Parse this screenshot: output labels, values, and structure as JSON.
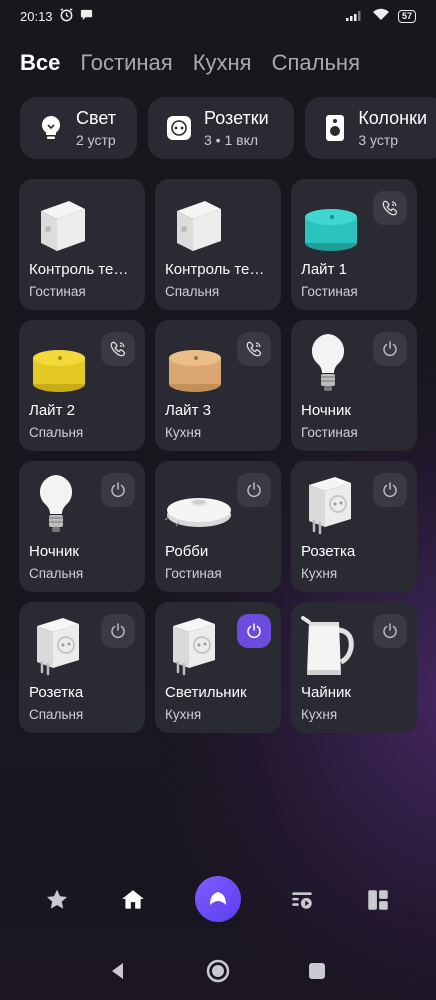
{
  "status_bar": {
    "time": "20:13",
    "battery": "57",
    "icons": [
      "alarm-icon",
      "chat-icon",
      "signal-icon",
      "wifi-icon",
      "battery-icon"
    ]
  },
  "rooms": [
    "Все",
    "Гостиная",
    "Кухня",
    "Спальня"
  ],
  "active_room": "Все",
  "categories": [
    {
      "label": "Свет",
      "sub": "2 устр",
      "icon": "light-bulb-icon"
    },
    {
      "label": "Розетки",
      "sub": "3 • 1 вкл",
      "icon": "socket-icon"
    },
    {
      "label": "Колонки",
      "sub": "3 устр",
      "icon": "speaker-icon"
    }
  ],
  "devices": [
    {
      "name": "Контроль те…",
      "room": "Гостиная",
      "image": "hub-icon",
      "action": null
    },
    {
      "name": "Контроль те…",
      "room": "Спальня",
      "image": "hub-icon",
      "action": null
    },
    {
      "name": "Лайт 1",
      "room": "Гостиная",
      "image": "speaker-teal-icon",
      "action": "call",
      "on": false
    },
    {
      "name": "Лайт 2",
      "room": "Спальня",
      "image": "speaker-yellow-icon",
      "action": "call",
      "on": false
    },
    {
      "name": "Лайт 3",
      "room": "Кухня",
      "image": "speaker-beige-icon",
      "action": "call",
      "on": false
    },
    {
      "name": "Ночник",
      "room": "Гостиная",
      "image": "bulb-icon",
      "action": "power",
      "on": false
    },
    {
      "name": "Ночник",
      "room": "Спальня",
      "image": "bulb-icon",
      "action": "power",
      "on": false
    },
    {
      "name": "Робби",
      "room": "Гостиная",
      "image": "robot-vacuum-icon",
      "action": "power",
      "on": false
    },
    {
      "name": "Розетка",
      "room": "Кухня",
      "image": "smart-plug-icon",
      "action": "power",
      "on": false
    },
    {
      "name": "Розетка",
      "room": "Спальня",
      "image": "smart-plug-icon",
      "action": "power",
      "on": false
    },
    {
      "name": "Светильник",
      "room": "Кухня",
      "image": "smart-plug-icon",
      "action": "power",
      "on": true
    },
    {
      "name": "Чайник",
      "room": "Кухня",
      "image": "kettle-icon",
      "action": "power",
      "on": false
    }
  ],
  "bottom_nav": [
    "star-icon",
    "home-icon",
    "alice-icon",
    "scenarios-icon",
    "dashboard-icon"
  ],
  "colors": {
    "accent": "#6d4bdc",
    "card": "#2a2a32",
    "background": "#17171c"
  }
}
